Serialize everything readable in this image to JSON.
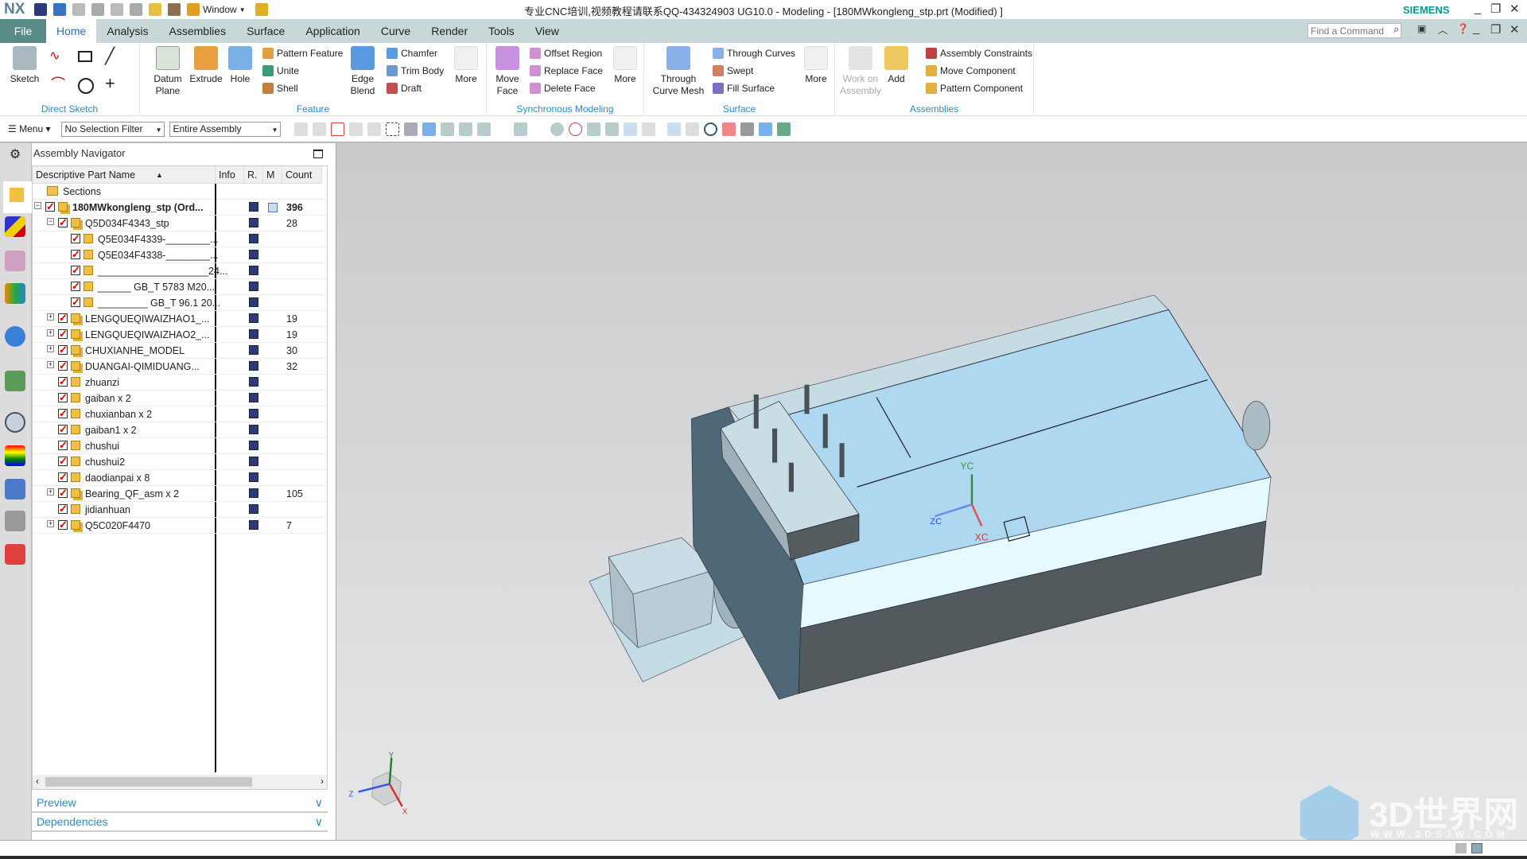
{
  "app": {
    "logo": "NX",
    "title": "专业CNC培训,视频教程请联系QQ-434324903 UG10.0 - Modeling - [180MWkongleng_stp.prt (Modified) ]",
    "brand": "SIEMENS",
    "window_menu": "Window"
  },
  "tabs": [
    {
      "label": "File"
    },
    {
      "label": "Home"
    },
    {
      "label": "Analysis"
    },
    {
      "label": "Assemblies"
    },
    {
      "label": "Surface"
    },
    {
      "label": "Application"
    },
    {
      "label": "Curve"
    },
    {
      "label": "Render"
    },
    {
      "label": "Tools"
    },
    {
      "label": "View"
    }
  ],
  "find_command": {
    "placeholder": "Find a Command"
  },
  "ribbon": {
    "direct_sketch": {
      "label": "Direct Sketch",
      "sketch": "Sketch"
    },
    "feature": {
      "label": "Feature",
      "datum_plane": "Datum Plane",
      "extrude": "Extrude",
      "hole": "Hole",
      "pattern_feature": "Pattern Feature",
      "unite": "Unite",
      "shell": "Shell",
      "edge_blend": "Edge Blend",
      "chamfer": "Chamfer",
      "trim_body": "Trim Body",
      "draft": "Draft",
      "more": "More"
    },
    "sync": {
      "label": "Synchronous Modeling",
      "move_face": "Move Face",
      "offset_region": "Offset Region",
      "replace_face": "Replace Face",
      "delete_face": "Delete Face",
      "more": "More"
    },
    "surface": {
      "label": "Surface",
      "through_curve_mesh": "Through Curve Mesh",
      "through_curves": "Through Curves",
      "swept": "Swept",
      "fill_surface": "Fill Surface",
      "more": "More"
    },
    "assemblies": {
      "label": "Assemblies",
      "work_on_assembly": "Work on Assembly",
      "add": "Add",
      "assembly_constraints": "Assembly Constraints",
      "move_component": "Move Component",
      "pattern_component": "Pattern Component"
    }
  },
  "toolbar": {
    "menu": "Menu",
    "selection_filter": "No Selection Filter",
    "scope": "Entire Assembly"
  },
  "navigator": {
    "title": "Assembly Navigator",
    "columns": [
      "Descriptive Part Name",
      "Info",
      "R.",
      "M",
      "Count"
    ],
    "sections": "Sections",
    "rows": [
      {
        "name": "180MWkongleng_stp (Ord...",
        "count": "396",
        "level": 0,
        "expander": "-",
        "assembly": true,
        "bold": true,
        "modified": true
      },
      {
        "name": "Q5D034F4343_stp",
        "count": "28",
        "level": 1,
        "expander": "-",
        "assembly": true
      },
      {
        "name": "Q5E034F4339-________...",
        "count": "",
        "level": 2,
        "expander": "",
        "assembly": false
      },
      {
        "name": "Q5E034F4338-________...",
        "count": "",
        "level": 2,
        "expander": "",
        "assembly": false
      },
      {
        "name": "____________________24...",
        "count": "",
        "level": 2,
        "expander": "",
        "assembly": false
      },
      {
        "name": "______ GB_T 5783 M20...",
        "count": "",
        "level": 2,
        "expander": "",
        "assembly": false
      },
      {
        "name": "_________ GB_T 96.1 20...",
        "count": "",
        "level": 2,
        "expander": "",
        "assembly": false
      },
      {
        "name": "LENGQUEQIWAIZHAO1_...",
        "count": "19",
        "level": 1,
        "expander": "+",
        "assembly": true
      },
      {
        "name": "LENGQUEQIWAIZHAO2_...",
        "count": "19",
        "level": 1,
        "expander": "+",
        "assembly": true
      },
      {
        "name": "CHUXIANHE_MODEL",
        "count": "30",
        "level": 1,
        "expander": "+",
        "assembly": true
      },
      {
        "name": "DUANGAI-QIMIDUANG...",
        "count": "32",
        "level": 1,
        "expander": "+",
        "assembly": true
      },
      {
        "name": "zhuanzi",
        "count": "",
        "level": 1,
        "expander": "",
        "assembly": false
      },
      {
        "name": "gaiban x 2",
        "count": "",
        "level": 1,
        "expander": "",
        "assembly": false
      },
      {
        "name": "chuxianban x 2",
        "count": "",
        "level": 1,
        "expander": "",
        "assembly": false
      },
      {
        "name": "gaiban1 x 2",
        "count": "",
        "level": 1,
        "expander": "",
        "assembly": false
      },
      {
        "name": "chushui",
        "count": "",
        "level": 1,
        "expander": "",
        "assembly": false
      },
      {
        "name": "chushui2",
        "count": "",
        "level": 1,
        "expander": "",
        "assembly": false
      },
      {
        "name": "daodianpai x 8",
        "count": "",
        "level": 1,
        "expander": "",
        "assembly": false
      },
      {
        "name": "Bearing_QF_asm x 2",
        "count": "105",
        "level": 1,
        "expander": "+",
        "assembly": true
      },
      {
        "name": "jidianhuan",
        "count": "",
        "level": 1,
        "expander": "",
        "assembly": false
      },
      {
        "name": "Q5C020F4470",
        "count": "7",
        "level": 1,
        "expander": "+",
        "assembly": true
      }
    ],
    "panels": [
      "Preview",
      "Dependencies"
    ]
  },
  "viewport": {
    "wcs_labels": {
      "x": "XC",
      "y": "YC",
      "z": "ZC"
    },
    "triad_labels": {
      "x": "X",
      "y": "Y",
      "z": "Z"
    },
    "watermark": {
      "text": "3D世界网",
      "url": "WWW.3DSJW.COM"
    }
  },
  "colors": {
    "accent": "#2a8cc8",
    "tab_bar": "#c8d8d8",
    "file_tab": "#5a8a86",
    "brand": "#009999",
    "model_top": "#aed8f0",
    "model_dark": "#525a5e"
  }
}
